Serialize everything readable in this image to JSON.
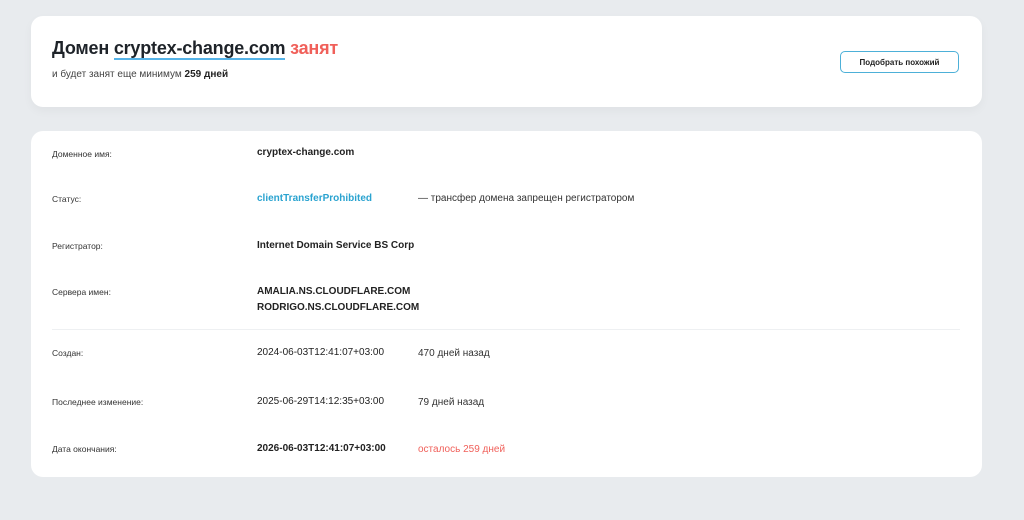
{
  "header": {
    "title_prefix": "Домен",
    "domain": "cryptex-change.com",
    "status_word": "занят",
    "subtitle_text": "и будет занят еще минимум",
    "subtitle_days": "259 дней",
    "similar_button": "Подобрать похожий"
  },
  "info": {
    "domain_name": {
      "label": "Доменное имя:",
      "value": "cryptex-change.com"
    },
    "status": {
      "label": "Статус:",
      "value": "clientTransferProhibited",
      "note": "— трансфер домена запрещен регистратором"
    },
    "registrar": {
      "label": "Регистратор:",
      "value": "Internet Domain Service BS Corp"
    },
    "nameservers": {
      "label": "Сервера имен:",
      "values": [
        "AMALIA.NS.CLOUDFLARE.COM",
        "RODRIGO.NS.CLOUDFLARE.COM"
      ]
    },
    "created": {
      "label": "Создан:",
      "value": "2024-06-03T12:41:07+03:00",
      "note": "470 дней назад"
    },
    "updated": {
      "label": "Последнее изменение:",
      "value": "2025-06-29T14:12:35+03:00",
      "note": "79 дней назад"
    },
    "expires": {
      "label": "Дата окончания:",
      "value": "2026-06-03T12:41:07+03:00",
      "note": "осталось 259 дней"
    }
  },
  "colors": {
    "accent": "#4db0d8",
    "link": "#2aa3d0",
    "busy": "#f0605a",
    "background": "#e8ebee"
  }
}
